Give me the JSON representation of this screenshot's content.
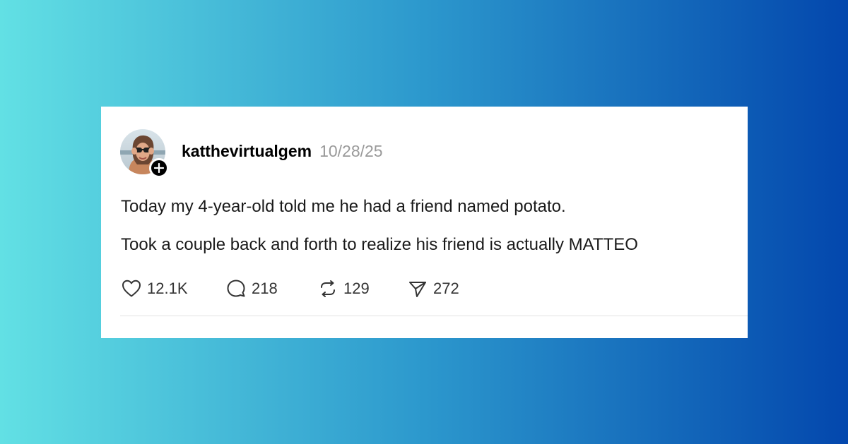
{
  "colors": {
    "gradient_start": "#62e0e4",
    "gradient_end": "#0347ad",
    "card": "#ffffff",
    "username": "#000000",
    "timestamp": "#9a9a9a"
  },
  "post": {
    "username": "katthevirtualgem",
    "timestamp": "10/28/25",
    "text_lines": [
      "Today my 4-year-old told me he had a friend named potato.",
      "Took a couple back and forth to realize his friend is actually MATTEO"
    ],
    "avatar_icon": "profile-photo",
    "follow_icon": "plus-icon"
  },
  "actions": {
    "like": {
      "icon": "heart-icon",
      "count": "12.1K"
    },
    "reply": {
      "icon": "speech-bubble-icon",
      "count": "218"
    },
    "repost": {
      "icon": "repost-icon",
      "count": "129"
    },
    "share": {
      "icon": "send-icon",
      "count": "272"
    }
  }
}
